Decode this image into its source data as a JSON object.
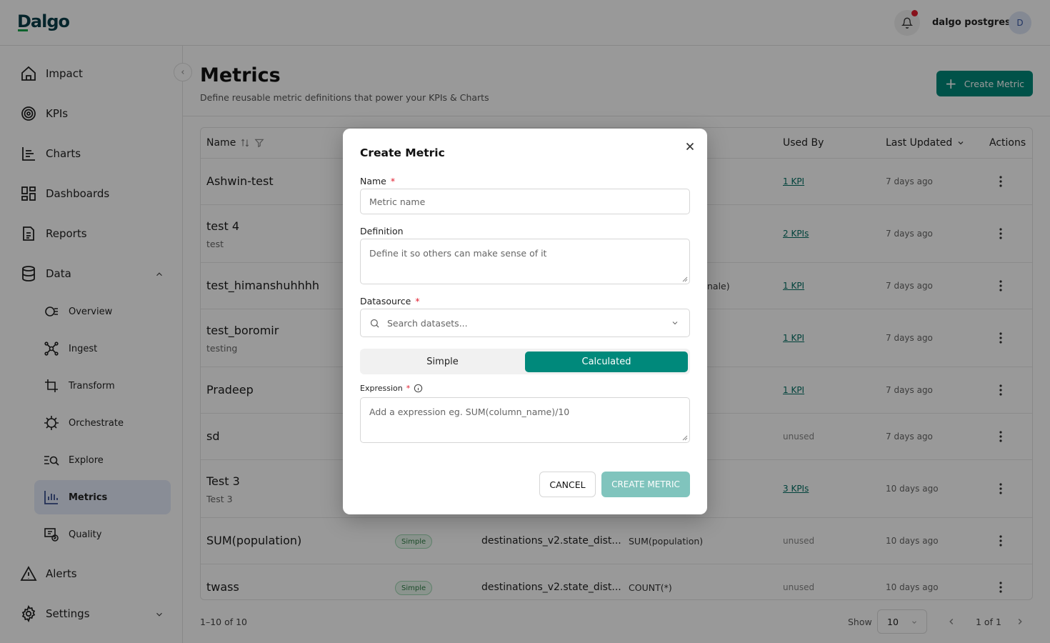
{
  "app": {
    "logo": "Dalgo",
    "user_name": "dalgo postgres",
    "avatar_initial": "D"
  },
  "sidebar": {
    "items": [
      {
        "label": "Impact"
      },
      {
        "label": "KPIs"
      },
      {
        "label": "Charts"
      },
      {
        "label": "Dashboards"
      },
      {
        "label": "Reports"
      },
      {
        "label": "Data"
      },
      {
        "label": "Alerts"
      },
      {
        "label": "Settings"
      }
    ],
    "data_subitems": [
      {
        "label": "Overview"
      },
      {
        "label": "Ingest"
      },
      {
        "label": "Transform"
      },
      {
        "label": "Orchestrate"
      },
      {
        "label": "Explore"
      },
      {
        "label": "Metrics"
      },
      {
        "label": "Quality"
      }
    ]
  },
  "page": {
    "title": "Metrics",
    "subtitle": "Define reusable metric definitions that power your KPIs & Charts",
    "create_label": "Create Metric"
  },
  "table": {
    "headers": {
      "name": "Name",
      "used_by": "Used By",
      "last_updated": "Last Updated",
      "actions": "Actions"
    },
    "rows": [
      {
        "name": "Ashwin-test",
        "desc": "",
        "type": "",
        "datasource": "",
        "expr": "",
        "used_by": "1 KPI",
        "updated": "7 days ago"
      },
      {
        "name": "test 4",
        "desc": "test",
        "type": "",
        "datasource": "",
        "expr": "",
        "used_by": "2 KPIs",
        "updated": "7 days ago"
      },
      {
        "name": "test_himanshuhhhh",
        "desc": "",
        "type": "",
        "datasource": "",
        "expr": "nale)",
        "used_by": "1 KPI",
        "updated": "7 days ago"
      },
      {
        "name": "test_boromir",
        "desc": "testing",
        "type": "",
        "datasource": "",
        "expr": "",
        "used_by": "1 KPI",
        "updated": "7 days ago"
      },
      {
        "name": "Pradeep",
        "desc": "",
        "type": "",
        "datasource": "",
        "expr": "",
        "used_by": "1 KPI",
        "updated": "7 days ago"
      },
      {
        "name": "sd",
        "desc": "",
        "type": "",
        "datasource": "",
        "expr": "",
        "used_by": "unused",
        "updated": "7 days ago"
      },
      {
        "name": "Test 3",
        "desc": "Test 3",
        "type": "",
        "datasource": "",
        "expr": "",
        "used_by": "3 KPIs",
        "updated": "10 days ago"
      },
      {
        "name": "SUM(population)",
        "desc": "",
        "type": "Simple",
        "datasource": "destinations_v2.state_dist...",
        "expr": "SUM(population)",
        "used_by": "unused",
        "updated": "10 days ago"
      },
      {
        "name": "twass",
        "desc": "",
        "type": "Simple",
        "datasource": "destinations_v2.state_dist...",
        "expr": "COUNT(*)",
        "used_by": "unused",
        "updated": "10 days ago"
      }
    ]
  },
  "pagination": {
    "range": "1–10 of 10",
    "show_label": "Show",
    "page_size": "10",
    "page_info": "1 of 1"
  },
  "modal": {
    "title": "Create Metric",
    "name_label": "Name",
    "name_placeholder": "Metric name",
    "definition_label": "Definition",
    "definition_placeholder": "Define it so others can make sense of it",
    "datasource_label": "Datasource",
    "datasource_placeholder": "Search datasets...",
    "mode_simple": "Simple",
    "mode_calculated": "Calculated",
    "expression_label": "Expression",
    "expression_placeholder": "Add a expression eg. SUM(column_name)/10",
    "cancel_label": "CANCEL",
    "create_label": "CREATE METRIC",
    "required_mark": "*"
  },
  "colors": {
    "accent": "#00897b",
    "accent_disabled": "#80c4bd",
    "required": "#e11d2e",
    "active_nav_bg": "#e4ebfa"
  }
}
